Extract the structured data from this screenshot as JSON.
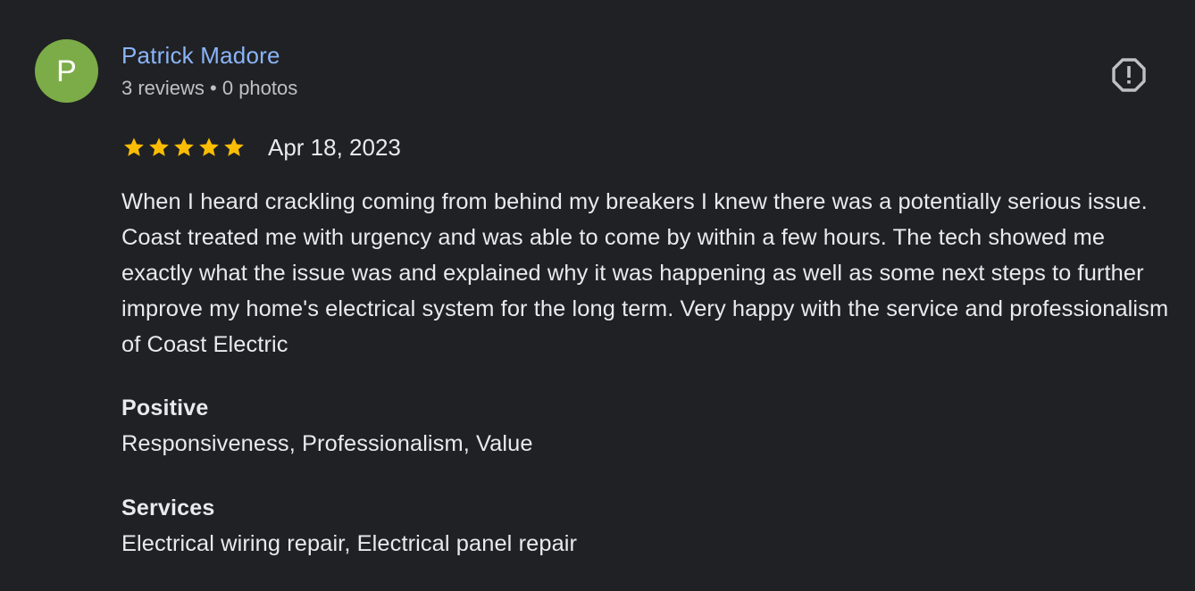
{
  "reviewer": {
    "initial": "P",
    "name": "Patrick Madore",
    "meta": "3 reviews • 0 photos",
    "avatar_color": "#7cac48"
  },
  "flag": {
    "icon": "report-flag-icon"
  },
  "rating": {
    "stars": 5,
    "max_stars": 5,
    "star_color": "#fbbc04",
    "date": "Apr 18, 2023"
  },
  "review": {
    "text": "When I heard crackling coming from behind my breakers I knew there was a potentially serious issue. Coast treated me with urgency and was able to come by within a few hours. The tech showed me exactly what the issue was and explained why it was happening as well as some next steps to further improve my home's electrical system for the long term. Very happy with the service and professionalism of Coast Electric"
  },
  "attributes": {
    "positive": {
      "title": "Positive",
      "value": "Responsiveness, Professionalism, Value"
    },
    "services": {
      "title": "Services",
      "value": "Electrical wiring repair, Electrical panel repair"
    }
  },
  "colors": {
    "background": "#202124",
    "name_link": "#8ab4f8",
    "meta_text": "#bdc1c6",
    "body_text": "#e8eaed"
  }
}
